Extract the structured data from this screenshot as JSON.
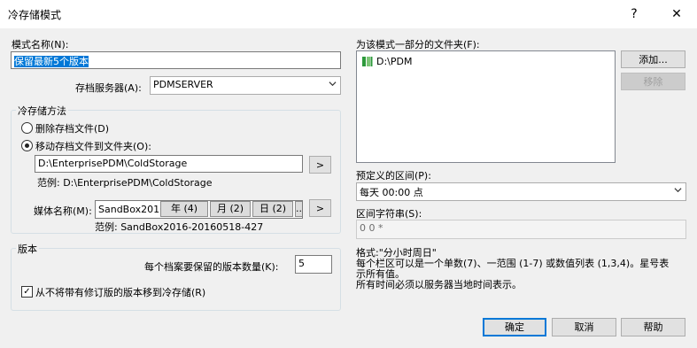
{
  "window": {
    "title": "冷存储模式",
    "help_label": "?",
    "close_label": "✕"
  },
  "scheme_name": {
    "label": "模式名称(N):",
    "value": "保留最新5个版本"
  },
  "archive_server": {
    "label": "存档服务器(A):",
    "value": "PDMSERVER"
  },
  "cold_storage_method": {
    "group_label": "冷存储方法",
    "delete_option": "删除存档文件(D)",
    "move_option": "移动存档文件到文件夹(O):",
    "folder_path": "D:\\EnterprisePDM\\ColdStorage",
    "browse_label": ">",
    "example_path": "范例: D:\\EnterprisePDM\\ColdStorage",
    "media_label": "媒体名称(M):",
    "media_value": "SandBox2016-",
    "media_tokens": [
      "年 (4)",
      "月 (2)",
      "日 (2)",
      "..."
    ],
    "media_browse_label": ">",
    "media_example": "范例: SandBox2016-20160518-427"
  },
  "versions": {
    "group_label": "版本",
    "keep_label": "每个档案要保留的版本数量(K):",
    "keep_value": "5",
    "no_move_revision_label": "从不将带有修订版的版本移到冷存储(R)",
    "no_move_revision_checked": "✓"
  },
  "folders": {
    "label": "为该模式一部分的文件夹(F):",
    "items": [
      {
        "icon": "folder-icon",
        "path": "D:\\PDM"
      }
    ],
    "add_label": "添加...",
    "remove_label": "移除"
  },
  "interval": {
    "label": "预定义的区间(P):",
    "value": "每天 00:00 点"
  },
  "interval_string": {
    "label": "区间字符串(S):",
    "value": "0 0 *"
  },
  "format_help": {
    "line1": "格式:\"分小时周日\"",
    "line2": "每个栏区可以是一个单数(7)、一范围 (1-7) 或数值列表 (1,3,4)。星号表",
    "line3": "示所有值。",
    "line4": "所有时间必须以服务器当地时间表示。"
  },
  "footer": {
    "ok_label": "确定",
    "cancel_label": "取消",
    "help_label": "帮助"
  },
  "colors": {
    "accent": "#0078d7",
    "folder": "#2e9a3c"
  }
}
